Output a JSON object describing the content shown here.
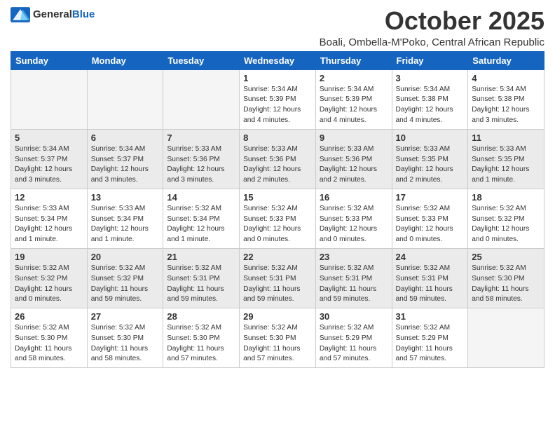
{
  "logo": {
    "general": "General",
    "blue": "Blue"
  },
  "title": "October 2025",
  "subtitle": "Boali, Ombella-M'Poko, Central African Republic",
  "headers": [
    "Sunday",
    "Monday",
    "Tuesday",
    "Wednesday",
    "Thursday",
    "Friday",
    "Saturday"
  ],
  "weeks": [
    [
      {
        "day": "",
        "text": ""
      },
      {
        "day": "",
        "text": ""
      },
      {
        "day": "",
        "text": ""
      },
      {
        "day": "1",
        "text": "Sunrise: 5:34 AM\nSunset: 5:39 PM\nDaylight: 12 hours\nand 4 minutes."
      },
      {
        "day": "2",
        "text": "Sunrise: 5:34 AM\nSunset: 5:39 PM\nDaylight: 12 hours\nand 4 minutes."
      },
      {
        "day": "3",
        "text": "Sunrise: 5:34 AM\nSunset: 5:38 PM\nDaylight: 12 hours\nand 4 minutes."
      },
      {
        "day": "4",
        "text": "Sunrise: 5:34 AM\nSunset: 5:38 PM\nDaylight: 12 hours\nand 3 minutes."
      }
    ],
    [
      {
        "day": "5",
        "text": "Sunrise: 5:34 AM\nSunset: 5:37 PM\nDaylight: 12 hours\nand 3 minutes."
      },
      {
        "day": "6",
        "text": "Sunrise: 5:34 AM\nSunset: 5:37 PM\nDaylight: 12 hours\nand 3 minutes."
      },
      {
        "day": "7",
        "text": "Sunrise: 5:33 AM\nSunset: 5:36 PM\nDaylight: 12 hours\nand 3 minutes."
      },
      {
        "day": "8",
        "text": "Sunrise: 5:33 AM\nSunset: 5:36 PM\nDaylight: 12 hours\nand 2 minutes."
      },
      {
        "day": "9",
        "text": "Sunrise: 5:33 AM\nSunset: 5:36 PM\nDaylight: 12 hours\nand 2 minutes."
      },
      {
        "day": "10",
        "text": "Sunrise: 5:33 AM\nSunset: 5:35 PM\nDaylight: 12 hours\nand 2 minutes."
      },
      {
        "day": "11",
        "text": "Sunrise: 5:33 AM\nSunset: 5:35 PM\nDaylight: 12 hours\nand 1 minute."
      }
    ],
    [
      {
        "day": "12",
        "text": "Sunrise: 5:33 AM\nSunset: 5:34 PM\nDaylight: 12 hours\nand 1 minute."
      },
      {
        "day": "13",
        "text": "Sunrise: 5:33 AM\nSunset: 5:34 PM\nDaylight: 12 hours\nand 1 minute."
      },
      {
        "day": "14",
        "text": "Sunrise: 5:32 AM\nSunset: 5:34 PM\nDaylight: 12 hours\nand 1 minute."
      },
      {
        "day": "15",
        "text": "Sunrise: 5:32 AM\nSunset: 5:33 PM\nDaylight: 12 hours\nand 0 minutes."
      },
      {
        "day": "16",
        "text": "Sunrise: 5:32 AM\nSunset: 5:33 PM\nDaylight: 12 hours\nand 0 minutes."
      },
      {
        "day": "17",
        "text": "Sunrise: 5:32 AM\nSunset: 5:33 PM\nDaylight: 12 hours\nand 0 minutes."
      },
      {
        "day": "18",
        "text": "Sunrise: 5:32 AM\nSunset: 5:32 PM\nDaylight: 12 hours\nand 0 minutes."
      }
    ],
    [
      {
        "day": "19",
        "text": "Sunrise: 5:32 AM\nSunset: 5:32 PM\nDaylight: 12 hours\nand 0 minutes."
      },
      {
        "day": "20",
        "text": "Sunrise: 5:32 AM\nSunset: 5:32 PM\nDaylight: 11 hours\nand 59 minutes."
      },
      {
        "day": "21",
        "text": "Sunrise: 5:32 AM\nSunset: 5:31 PM\nDaylight: 11 hours\nand 59 minutes."
      },
      {
        "day": "22",
        "text": "Sunrise: 5:32 AM\nSunset: 5:31 PM\nDaylight: 11 hours\nand 59 minutes."
      },
      {
        "day": "23",
        "text": "Sunrise: 5:32 AM\nSunset: 5:31 PM\nDaylight: 11 hours\nand 59 minutes."
      },
      {
        "day": "24",
        "text": "Sunrise: 5:32 AM\nSunset: 5:31 PM\nDaylight: 11 hours\nand 59 minutes."
      },
      {
        "day": "25",
        "text": "Sunrise: 5:32 AM\nSunset: 5:30 PM\nDaylight: 11 hours\nand 58 minutes."
      }
    ],
    [
      {
        "day": "26",
        "text": "Sunrise: 5:32 AM\nSunset: 5:30 PM\nDaylight: 11 hours\nand 58 minutes."
      },
      {
        "day": "27",
        "text": "Sunrise: 5:32 AM\nSunset: 5:30 PM\nDaylight: 11 hours\nand 58 minutes."
      },
      {
        "day": "28",
        "text": "Sunrise: 5:32 AM\nSunset: 5:30 PM\nDaylight: 11 hours\nand 57 minutes."
      },
      {
        "day": "29",
        "text": "Sunrise: 5:32 AM\nSunset: 5:30 PM\nDaylight: 11 hours\nand 57 minutes."
      },
      {
        "day": "30",
        "text": "Sunrise: 5:32 AM\nSunset: 5:29 PM\nDaylight: 11 hours\nand 57 minutes."
      },
      {
        "day": "31",
        "text": "Sunrise: 5:32 AM\nSunset: 5:29 PM\nDaylight: 11 hours\nand 57 minutes."
      },
      {
        "day": "",
        "text": ""
      }
    ]
  ]
}
